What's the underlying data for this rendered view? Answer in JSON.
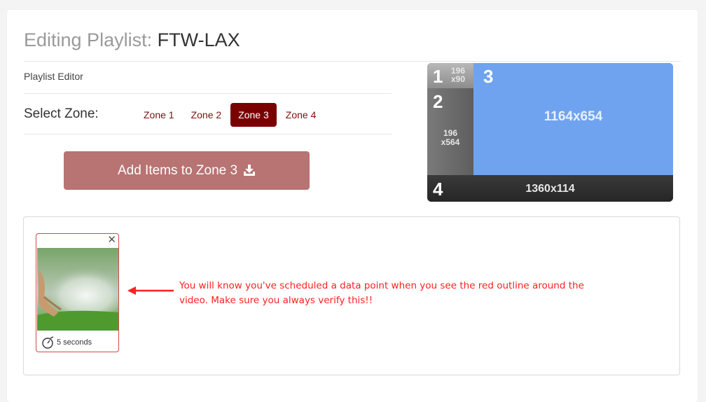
{
  "header": {
    "title_prefix": "Editing Playlist:",
    "playlist_name": "FTW-LAX"
  },
  "editor": {
    "section_label": "Playlist Editor",
    "select_zone_label": "Select Zone:",
    "zones": [
      "Zone 1",
      "Zone 2",
      "Zone 3",
      "Zone 4"
    ],
    "active_zone": "Zone 3",
    "add_button_label": "Add Items to Zone 3"
  },
  "layout_preview": {
    "zone1": {
      "number": "1",
      "dim_w": "196",
      "dim_h": "x90"
    },
    "zone2": {
      "number": "2",
      "dim_w": "196",
      "dim_h": "x564"
    },
    "zone3": {
      "number": "3",
      "dim": "1164x654"
    },
    "zone4": {
      "number": "4",
      "dim": "1360x114"
    }
  },
  "items": [
    {
      "duration": "5 seconds"
    }
  ],
  "annotation": {
    "text": "You will know you've scheduled a data point when you see the red outline around the video.  Make sure you always verify this!!"
  },
  "colors": {
    "active_tab": "#7a0000",
    "add_button": "#b87373",
    "zone3_fill": "#6fa3ef",
    "annotation": "#ff2020",
    "item_outline": "#d64848"
  }
}
